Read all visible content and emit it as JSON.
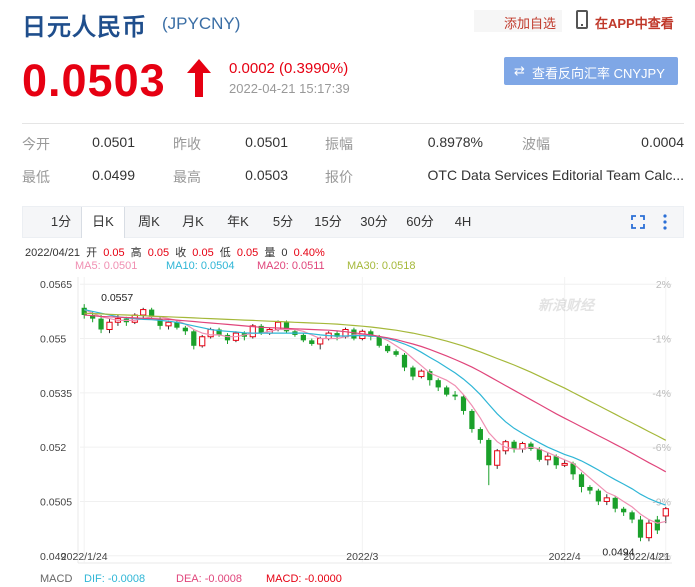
{
  "header": {
    "title": "日元人民币",
    "code": "(JPYCNY)",
    "add_favorite": "添加自选",
    "app_view": "在APP中查看"
  },
  "quote": {
    "price": "0.0503",
    "change": "0.0002 (0.3990%)",
    "timestamp": "2022-04-21 15:17:39",
    "reverse_button": "查看反向汇率 CNYJPY",
    "up_color": "#e60012"
  },
  "info": {
    "open_label": "今开",
    "open": "0.0501",
    "prev_close_label": "昨收",
    "prev_close": "0.0501",
    "amplitude_label": "振幅",
    "amplitude": "0.8978%",
    "volatility_label": "波幅",
    "volatility": "0.0004",
    "low_label": "最低",
    "low": "0.0499",
    "high_label": "最高",
    "high": "0.0503",
    "quote_label": "报价",
    "quote_source": "OTC Data Services Editorial Team Calc..."
  },
  "tabs": [
    "1分",
    "日K",
    "周K",
    "月K",
    "年K",
    "5分",
    "15分",
    "30分",
    "60分",
    "4H"
  ],
  "active_tab": "日K",
  "chart_header": {
    "date": "2022/04/21",
    "open_label": "开",
    "open": "0.05",
    "high_label": "高",
    "high": "0.05",
    "close_label": "收",
    "close": "0.05",
    "low_label": "低",
    "low": "0.05",
    "vol_label": "量",
    "vol": "0",
    "pct": "0.40%"
  },
  "ma_legend": [
    {
      "label": "MA5: 0.0501",
      "color": "#f08fb2"
    },
    {
      "label": "MA10: 0.0504",
      "color": "#2fb6d6"
    },
    {
      "label": "MA20: 0.0511",
      "color": "#e0457b"
    },
    {
      "label": "MA30: 0.0518",
      "color": "#a5b83a"
    }
  ],
  "macd": {
    "title": "MACD",
    "dif": "DIF: -0.0008",
    "dea": "DEA: -0.0008",
    "macd": "MACD: -0.0000"
  },
  "watermark": "新浪财经",
  "chart_data": {
    "type": "candlestick",
    "y_ticks": [
      "0.0565",
      "0.055",
      "0.0535",
      "0.052",
      "0.0505",
      "0.049"
    ],
    "y_tick_values": [
      0.0565,
      0.055,
      0.0535,
      0.052,
      0.0505,
      0.049
    ],
    "pct_ticks": [
      "2%",
      "-1%",
      "-4%",
      "-6%",
      "-9%",
      "-12%"
    ],
    "x_labels": [
      "2022/1/24",
      "2022/3",
      "2022/4",
      "2022/4/21"
    ],
    "x_label_index": [
      0,
      33,
      57,
      69
    ],
    "max_label": "0.0557",
    "min_label": "0.0494",
    "ylim": [
      0.0488,
      0.0567
    ],
    "up_color": "#e60012",
    "down_color": "#1aa02a",
    "candles": [
      [
        0.05585,
        0.05565,
        0.05595,
        0.05555
      ],
      [
        0.05565,
        0.05555,
        0.05575,
        0.05545
      ],
      [
        0.05555,
        0.05525,
        0.05565,
        0.05515
      ],
      [
        0.05525,
        0.05545,
        0.05555,
        0.05515
      ],
      [
        0.05545,
        0.05555,
        0.05565,
        0.05535
      ],
      [
        0.05555,
        0.05545,
        0.0556,
        0.05535
      ],
      [
        0.05545,
        0.05565,
        0.0557,
        0.0554
      ],
      [
        0.05565,
        0.0558,
        0.05585,
        0.05555
      ],
      [
        0.0558,
        0.0556,
        0.05585,
        0.05555
      ],
      [
        0.05555,
        0.05535,
        0.0556,
        0.05525
      ],
      [
        0.05535,
        0.05545,
        0.0555,
        0.05525
      ],
      [
        0.05545,
        0.0553,
        0.0555,
        0.05525
      ],
      [
        0.0553,
        0.0552,
        0.05535,
        0.0551
      ],
      [
        0.0552,
        0.0548,
        0.05525,
        0.0547
      ],
      [
        0.0548,
        0.05505,
        0.0551,
        0.05475
      ],
      [
        0.05505,
        0.05525,
        0.0553,
        0.055
      ],
      [
        0.05525,
        0.0551,
        0.0553,
        0.05505
      ],
      [
        0.0551,
        0.05495,
        0.05515,
        0.05485
      ],
      [
        0.05495,
        0.05515,
        0.0552,
        0.0549
      ],
      [
        0.05515,
        0.05505,
        0.0552,
        0.05495
      ],
      [
        0.05505,
        0.05535,
        0.0554,
        0.055
      ],
      [
        0.05535,
        0.05515,
        0.0554,
        0.0551
      ],
      [
        0.05515,
        0.05525,
        0.0553,
        0.0551
      ],
      [
        0.05525,
        0.05545,
        0.0555,
        0.0552
      ],
      [
        0.05545,
        0.0552,
        0.0555,
        0.05515
      ],
      [
        0.0552,
        0.0551,
        0.05525,
        0.05505
      ],
      [
        0.0551,
        0.05495,
        0.05515,
        0.0549
      ],
      [
        0.05495,
        0.05485,
        0.055,
        0.0548
      ],
      [
        0.05485,
        0.055,
        0.05505,
        0.0547
      ],
      [
        0.055,
        0.05515,
        0.0552,
        0.05495
      ],
      [
        0.05515,
        0.05505,
        0.0552,
        0.05495
      ],
      [
        0.05505,
        0.05525,
        0.0553,
        0.055
      ],
      [
        0.05525,
        0.055,
        0.0553,
        0.05495
      ],
      [
        0.055,
        0.0552,
        0.05525,
        0.05495
      ],
      [
        0.0552,
        0.05505,
        0.05525,
        0.05495
      ],
      [
        0.05505,
        0.0548,
        0.0551,
        0.05475
      ],
      [
        0.0548,
        0.05465,
        0.05485,
        0.0546
      ],
      [
        0.05465,
        0.05455,
        0.0547,
        0.0545
      ],
      [
        0.05455,
        0.0542,
        0.0546,
        0.0541
      ],
      [
        0.0542,
        0.05395,
        0.05425,
        0.05385
      ],
      [
        0.05395,
        0.0541,
        0.05415,
        0.0539
      ],
      [
        0.0541,
        0.05385,
        0.05415,
        0.0537
      ],
      [
        0.05385,
        0.05365,
        0.0539,
        0.05355
      ],
      [
        0.05365,
        0.05345,
        0.0537,
        0.0534
      ],
      [
        0.05345,
        0.0534,
        0.05355,
        0.0533
      ],
      [
        0.0534,
        0.053,
        0.05345,
        0.0529
      ],
      [
        0.053,
        0.0525,
        0.05305,
        0.0524
      ],
      [
        0.0525,
        0.0522,
        0.05255,
        0.0521
      ],
      [
        0.0522,
        0.0515,
        0.05225,
        0.05095
      ],
      [
        0.0515,
        0.0519,
        0.05195,
        0.0514
      ],
      [
        0.0519,
        0.05215,
        0.0522,
        0.0518
      ],
      [
        0.05215,
        0.05195,
        0.0522,
        0.05185
      ],
      [
        0.05195,
        0.0521,
        0.05215,
        0.05185
      ],
      [
        0.0521,
        0.05195,
        0.05215,
        0.0519
      ],
      [
        0.05195,
        0.05165,
        0.052,
        0.0516
      ],
      [
        0.05165,
        0.05175,
        0.05185,
        0.0515
      ],
      [
        0.05175,
        0.0515,
        0.0518,
        0.0514
      ],
      [
        0.0515,
        0.05155,
        0.05165,
        0.05145
      ],
      [
        0.05155,
        0.05125,
        0.0516,
        0.0511
      ],
      [
        0.05125,
        0.0509,
        0.0513,
        0.05075
      ],
      [
        0.0509,
        0.0508,
        0.05095,
        0.0507
      ],
      [
        0.0508,
        0.0505,
        0.05085,
        0.0504
      ],
      [
        0.0505,
        0.0506,
        0.0507,
        0.0504
      ],
      [
        0.0506,
        0.0503,
        0.05065,
        0.0502
      ],
      [
        0.0503,
        0.0502,
        0.05035,
        0.0501
      ],
      [
        0.0502,
        0.05,
        0.05025,
        0.0499
      ],
      [
        0.05,
        0.0495,
        0.0501,
        0.0494
      ],
      [
        0.0495,
        0.0499,
        0.05,
        0.0494
      ],
      [
        0.05,
        0.0497,
        0.0501,
        0.0496
      ],
      [
        0.0501,
        0.0503,
        0.05035,
        0.0499
      ]
    ],
    "ma5": [
      0.0558,
      0.0557,
      0.0556,
      0.05555,
      0.0555,
      0.0555,
      0.0555,
      0.05555,
      0.0556,
      0.0556,
      0.05555,
      0.0555,
      0.0554,
      0.05525,
      0.05515,
      0.0551,
      0.0551,
      0.05505,
      0.05505,
      0.0551,
      0.05515,
      0.05515,
      0.0552,
      0.05525,
      0.05525,
      0.05525,
      0.0552,
      0.0551,
      0.055,
      0.055,
      0.055,
      0.05505,
      0.0551,
      0.0551,
      0.0551,
      0.05505,
      0.05495,
      0.0548,
      0.05465,
      0.05445,
      0.05425,
      0.05405,
      0.05395,
      0.05385,
      0.0537,
      0.05345,
      0.05315,
      0.0528,
      0.0524,
      0.05215,
      0.052,
      0.05195,
      0.05195,
      0.052,
      0.05195,
      0.05185,
      0.05175,
      0.05165,
      0.05155,
      0.05135,
      0.05115,
      0.05095,
      0.05075,
      0.05065,
      0.0505,
      0.05035,
      0.05015,
      0.05,
      0.0499,
      0.04995
    ],
    "ma10": [
      0.0558,
      0.05575,
      0.0557,
      0.05565,
      0.0556,
      0.05557,
      0.05555,
      0.05553,
      0.05552,
      0.0555,
      0.05548,
      0.05545,
      0.0554,
      0.05535,
      0.0553,
      0.05525,
      0.05522,
      0.0552,
      0.05518,
      0.05516,
      0.05515,
      0.05515,
      0.05515,
      0.05515,
      0.05515,
      0.05515,
      0.05515,
      0.05513,
      0.0551,
      0.05508,
      0.05507,
      0.05507,
      0.05508,
      0.05508,
      0.05507,
      0.05505,
      0.055,
      0.05493,
      0.05485,
      0.05475,
      0.05462,
      0.05448,
      0.05435,
      0.0542,
      0.05405,
      0.05388,
      0.05368,
      0.05345,
      0.05318,
      0.05292,
      0.0527,
      0.05252,
      0.05238,
      0.05225,
      0.05212,
      0.052,
      0.0519,
      0.0518,
      0.05172,
      0.05162,
      0.0515,
      0.05137,
      0.05123,
      0.0511,
      0.05098,
      0.05085,
      0.0507,
      0.05058,
      0.05048,
      0.0504
    ],
    "ma20": [
      0.05565,
      0.05563,
      0.05561,
      0.0556,
      0.05559,
      0.05558,
      0.05557,
      0.05556,
      0.05555,
      0.05554,
      0.05553,
      0.05551,
      0.05549,
      0.05547,
      0.05545,
      0.05543,
      0.05541,
      0.05539,
      0.05537,
      0.05535,
      0.05533,
      0.05531,
      0.0553,
      0.05529,
      0.05528,
      0.05527,
      0.05526,
      0.05525,
      0.05524,
      0.05523,
      0.05521,
      0.05519,
      0.05516,
      0.05513,
      0.0551,
      0.05506,
      0.05502,
      0.05497,
      0.05491,
      0.05485,
      0.05478,
      0.0547,
      0.05461,
      0.05452,
      0.05442,
      0.05432,
      0.05421,
      0.05409,
      0.05396,
      0.05383,
      0.0537,
      0.05357,
      0.05344,
      0.05331,
      0.05318,
      0.05305,
      0.05292,
      0.0528,
      0.05268,
      0.05256,
      0.05244,
      0.05232,
      0.0522,
      0.05208,
      0.05196,
      0.05183,
      0.0517,
      0.05157,
      0.05145,
      0.05132
    ],
    "ma30": [
      0.0557,
      0.05569,
      0.05568,
      0.05567,
      0.05566,
      0.05565,
      0.05564,
      0.05563,
      0.05562,
      0.05561,
      0.0556,
      0.05559,
      0.05558,
      0.05557,
      0.05556,
      0.05555,
      0.05554,
      0.05553,
      0.05552,
      0.05551,
      0.0555,
      0.05549,
      0.05548,
      0.05547,
      0.05546,
      0.05545,
      0.05544,
      0.05543,
      0.05542,
      0.05541,
      0.0554,
      0.05538,
      0.05536,
      0.05534,
      0.05532,
      0.05529,
      0.05526,
      0.05523,
      0.05519,
      0.05515,
      0.0551,
      0.05505,
      0.05499,
      0.05493,
      0.05486,
      0.05479,
      0.05471,
      0.05463,
      0.05454,
      0.05445,
      0.05436,
      0.05427,
      0.05417,
      0.05407,
      0.05396,
      0.05385,
      0.05374,
      0.05363,
      0.05351,
      0.05339,
      0.05327,
      0.05315,
      0.05303,
      0.05291,
      0.05279,
      0.05267,
      0.05255,
      0.05243,
      0.05231,
      0.05219
    ]
  }
}
